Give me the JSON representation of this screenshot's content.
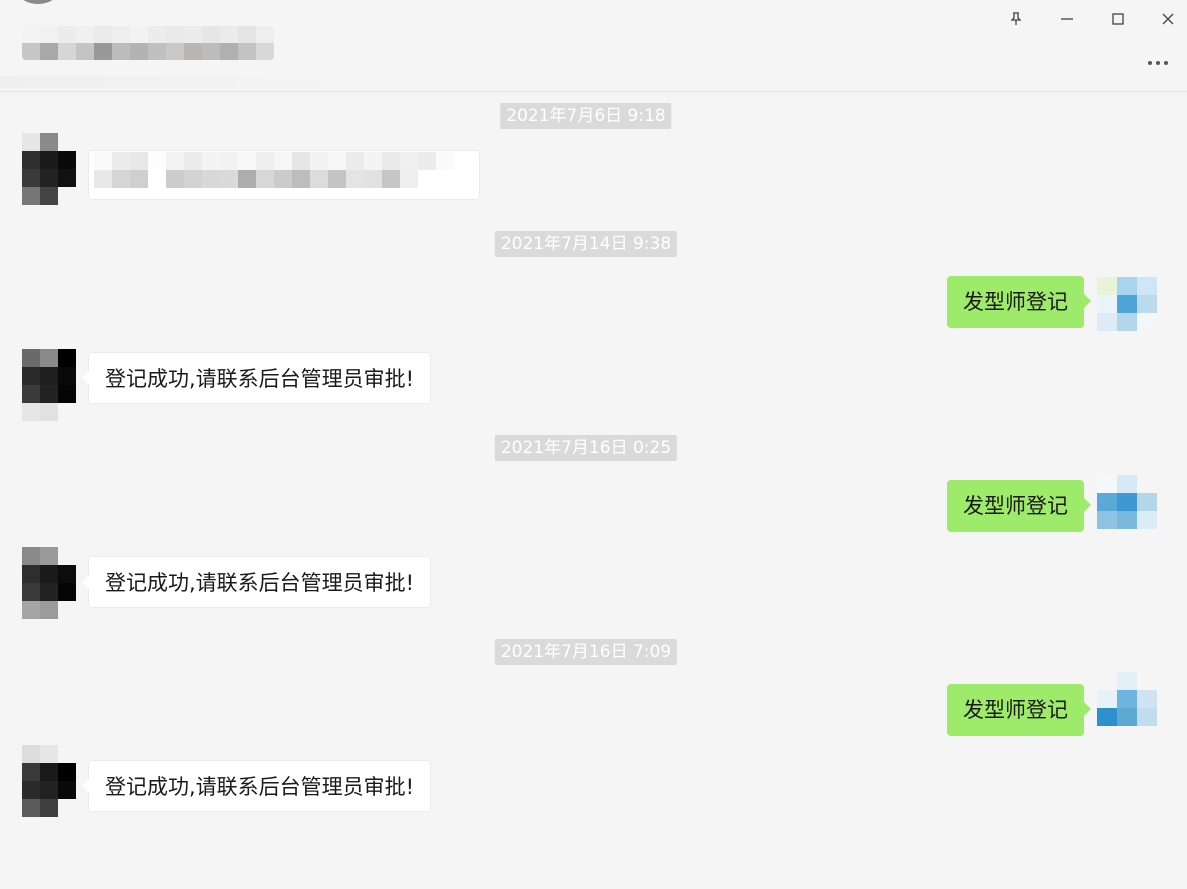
{
  "window": {
    "controls": {
      "pin_label": "Pin",
      "minimize_label": "Minimize",
      "maximize_label": "Maximize",
      "close_label": "Close",
      "more_label": "More"
    }
  },
  "messages": [
    {
      "type": "timestamp",
      "text": "2021年7月6日 9:18"
    },
    {
      "type": "incoming",
      "text": ""
    },
    {
      "type": "timestamp",
      "text": "2021年7月14日 9:38"
    },
    {
      "type": "outgoing",
      "text": "发型师登记"
    },
    {
      "type": "incoming",
      "text": "登记成功,请联系后台管理员审批!"
    },
    {
      "type": "timestamp",
      "text": "2021年7月16日 0:25"
    },
    {
      "type": "outgoing",
      "text": "发型师登记"
    },
    {
      "type": "incoming",
      "text": "登记成功,请联系后台管理员审批!"
    },
    {
      "type": "timestamp",
      "text": "2021年7月16日 7:09"
    },
    {
      "type": "outgoing",
      "text": "发型师登记"
    },
    {
      "type": "incoming",
      "text": "登记成功,请联系后台管理员审批!"
    }
  ],
  "colors": {
    "background": "#f5f5f5",
    "outgoing_bubble": "#9eea6a",
    "incoming_bubble": "#ffffff",
    "timestamp_bg": "#dadada"
  }
}
